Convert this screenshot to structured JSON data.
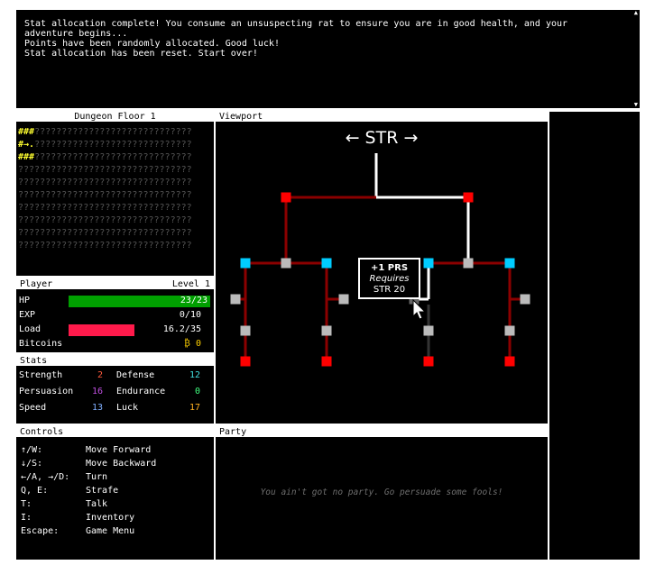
{
  "log": {
    "lines": [
      "Stat allocation complete! You consume an unsuspecting rat to ensure you are in good health, and your",
      "adventure begins...",
      "Points have been randomly allocated. Good luck!",
      "Stat allocation has been reset. Start over!"
    ],
    "scroll_up": "▲",
    "scroll_down": "▼"
  },
  "map": {
    "title": "Dungeon Floor 1",
    "rows": [
      {
        "hi": "###",
        "rest": "?????????????????????????????"
      },
      {
        "hi": "#→.",
        "rest": "?????????????????????????????"
      },
      {
        "hi": "###",
        "rest": "?????????????????????????????"
      },
      {
        "hi": "",
        "rest": "????????????????????????????????"
      },
      {
        "hi": "",
        "rest": "????????????????????????????????"
      },
      {
        "hi": "",
        "rest": "????????????????????????????????"
      },
      {
        "hi": "",
        "rest": "????????????????????????????????"
      },
      {
        "hi": "",
        "rest": "????????????????????????????????"
      },
      {
        "hi": "",
        "rest": "????????????????????????????????"
      },
      {
        "hi": "",
        "rest": "????????????????????????????????"
      }
    ]
  },
  "player": {
    "title": "Player",
    "level": "Level 1",
    "hp": {
      "label": "HP",
      "value": "23/23",
      "fraction": 1.0,
      "color": "#00a000"
    },
    "exp": {
      "label": "EXP",
      "value": "0/10",
      "fraction": 0.0
    },
    "load": {
      "label": "Load",
      "value": "16.2/35",
      "fraction": 0.463,
      "color": "#ff1a4b"
    },
    "bitcoins": {
      "label": "Bitcoins",
      "value": "₿ 0",
      "color": "#ffd000"
    }
  },
  "stats": {
    "title": "Stats",
    "items": [
      {
        "label": "Strength",
        "value": "2",
        "color": "#ff5a3c"
      },
      {
        "label": "Defense",
        "value": "12",
        "color": "#40e0e0"
      },
      {
        "label": "Persuasion",
        "value": "16",
        "color": "#c050e0"
      },
      {
        "label": "Endurance",
        "value": "0",
        "color": "#40ff80"
      },
      {
        "label": "Speed",
        "value": "13",
        "color": "#80b0ff"
      },
      {
        "label": "Luck",
        "value": "17",
        "color": "#ffb020"
      }
    ]
  },
  "controls": {
    "title": "Controls",
    "items": [
      {
        "key": "↑/W:",
        "action": "Move Forward"
      },
      {
        "key": "↓/S:",
        "action": "Move Backward"
      },
      {
        "key": "←/A, →/D:",
        "action": "Turn"
      },
      {
        "key": "Q, E:",
        "action": "Strafe"
      },
      {
        "key": "T:",
        "action": "Talk"
      },
      {
        "key": "I:",
        "action": "Inventory"
      },
      {
        "key": "Escape:",
        "action": "Game Menu"
      }
    ]
  },
  "viewport": {
    "title": "Viewport",
    "heading": "← STR →",
    "tooltip": {
      "line1": "+1 PRS",
      "line2": "Requires",
      "line3": "STR 20"
    }
  },
  "party": {
    "title": "Party",
    "empty_text": "You ain't got no party. Go persuade some fools!"
  },
  "colors": {
    "locked_node": "#ff0000",
    "active_node": "#00ccff",
    "inactive_node": "#bbbbbb",
    "edge": "#8b0000",
    "active_edge": "#ffffff"
  }
}
